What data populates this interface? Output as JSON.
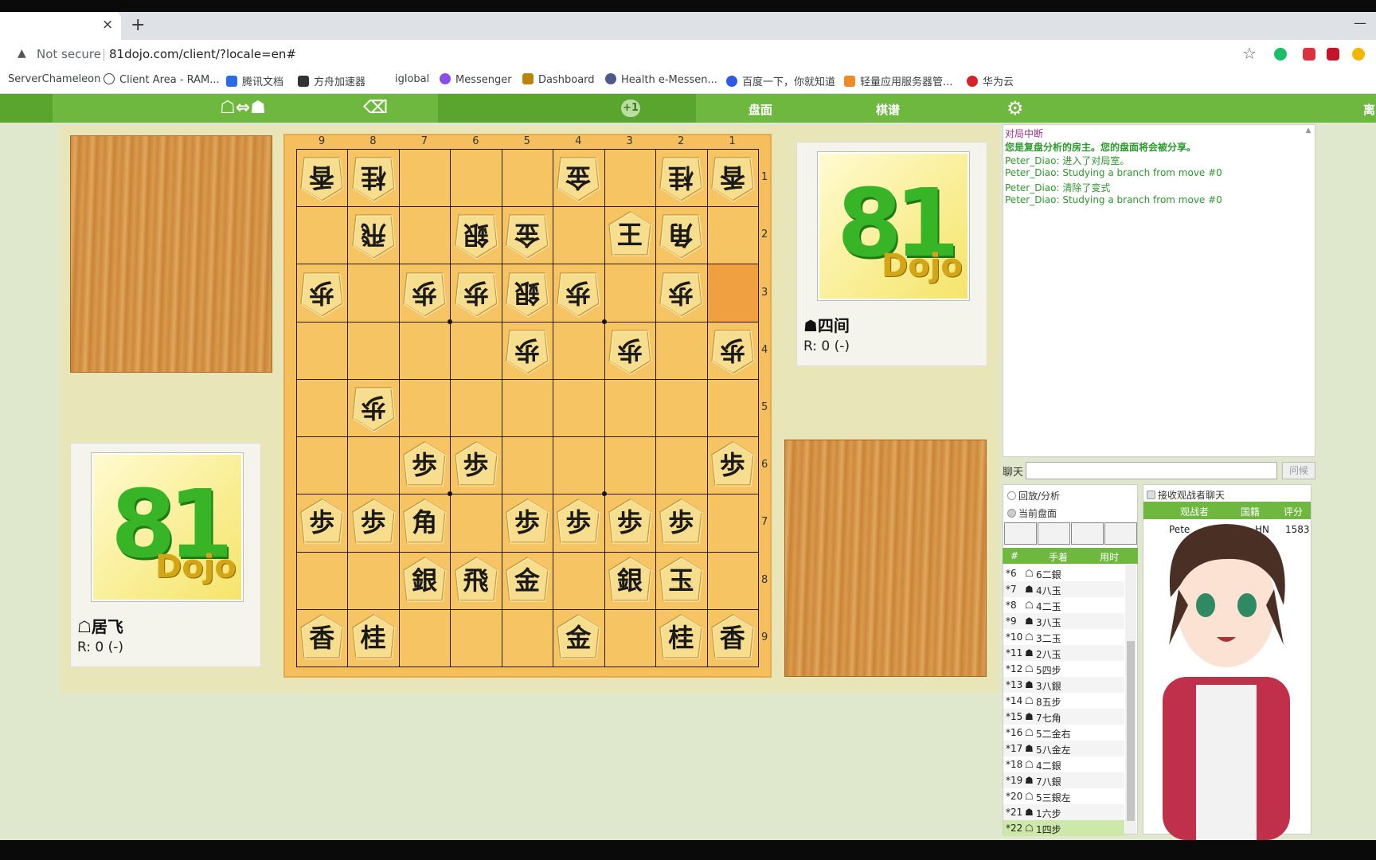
{
  "browser": {
    "tab_close": "×",
    "tab_new": "+",
    "security_label": "Not secure",
    "url": "81dojo.com/client/?locale=en#",
    "bookmarks": [
      "ServerChameleon",
      "Client Area - RAM...",
      "腾讯文档",
      "方舟加速器",
      "iglobal",
      "Messenger",
      "Dashboard",
      "Health e-Messen...",
      "百度一下，你就知道",
      "轻量应用服务器管...",
      "华为云"
    ]
  },
  "toolbar": {
    "plus_badge": "+1",
    "board_label": "盘面",
    "kifu_label": "棋谱",
    "leave_label": "离"
  },
  "board": {
    "files": [
      "9",
      "8",
      "7",
      "6",
      "5",
      "4",
      "3",
      "2",
      "1"
    ],
    "ranks": [
      "1",
      "2",
      "3",
      "4",
      "5",
      "6",
      "7",
      "8",
      "9"
    ],
    "pieces": [
      {
        "f": 9,
        "r": 1,
        "k": "香",
        "g": true
      },
      {
        "f": 8,
        "r": 1,
        "k": "桂",
        "g": true
      },
      {
        "f": 4,
        "r": 1,
        "k": "金",
        "g": true
      },
      {
        "f": 2,
        "r": 1,
        "k": "桂",
        "g": true
      },
      {
        "f": 1,
        "r": 1,
        "k": "香",
        "g": true
      },
      {
        "f": 8,
        "r": 2,
        "k": "飛",
        "g": true
      },
      {
        "f": 6,
        "r": 2,
        "k": "銀",
        "g": true
      },
      {
        "f": 5,
        "r": 2,
        "k": "金",
        "g": true
      },
      {
        "f": 3,
        "r": 2,
        "k": "王",
        "g": false
      },
      {
        "f": 2,
        "r": 2,
        "k": "角",
        "g": true
      },
      {
        "f": 9,
        "r": 3,
        "k": "歩",
        "g": true
      },
      {
        "f": 7,
        "r": 3,
        "k": "歩",
        "g": true
      },
      {
        "f": 6,
        "r": 3,
        "k": "歩",
        "g": true
      },
      {
        "f": 5,
        "r": 3,
        "k": "銀",
        "g": true
      },
      {
        "f": 4,
        "r": 3,
        "k": "歩",
        "g": true
      },
      {
        "f": 2,
        "r": 3,
        "k": "歩",
        "g": true
      },
      {
        "f": 5,
        "r": 4,
        "k": "歩",
        "g": true
      },
      {
        "f": 3,
        "r": 4,
        "k": "歩",
        "g": true
      },
      {
        "f": 1,
        "r": 4,
        "k": "歩",
        "g": true
      },
      {
        "f": 8,
        "r": 5,
        "k": "歩",
        "g": true
      },
      {
        "f": 7,
        "r": 6,
        "k": "歩",
        "g": false
      },
      {
        "f": 6,
        "r": 6,
        "k": "歩",
        "g": false
      },
      {
        "f": 1,
        "r": 6,
        "k": "歩",
        "g": false
      },
      {
        "f": 9,
        "r": 7,
        "k": "歩",
        "g": false
      },
      {
        "f": 8,
        "r": 7,
        "k": "歩",
        "g": false
      },
      {
        "f": 7,
        "r": 7,
        "k": "角",
        "g": false
      },
      {
        "f": 5,
        "r": 7,
        "k": "歩",
        "g": false
      },
      {
        "f": 4,
        "r": 7,
        "k": "歩",
        "g": false
      },
      {
        "f": 3,
        "r": 7,
        "k": "歩",
        "g": false
      },
      {
        "f": 2,
        "r": 7,
        "k": "歩",
        "g": false
      },
      {
        "f": 7,
        "r": 8,
        "k": "銀",
        "g": false
      },
      {
        "f": 6,
        "r": 8,
        "k": "飛",
        "g": false
      },
      {
        "f": 5,
        "r": 8,
        "k": "金",
        "g": false
      },
      {
        "f": 3,
        "r": 8,
        "k": "銀",
        "g": false
      },
      {
        "f": 2,
        "r": 8,
        "k": "玉",
        "g": false
      },
      {
        "f": 9,
        "r": 9,
        "k": "香",
        "g": false
      },
      {
        "f": 8,
        "r": 9,
        "k": "桂",
        "g": false
      },
      {
        "f": 4,
        "r": 9,
        "k": "金",
        "g": false
      },
      {
        "f": 2,
        "r": 9,
        "k": "桂",
        "g": false
      },
      {
        "f": 1,
        "r": 9,
        "k": "香",
        "g": false
      }
    ],
    "highlight": {
      "f": 1,
      "r": 3
    }
  },
  "players": {
    "top": {
      "name": "☗四间",
      "rating": "R: 0 (-)"
    },
    "bottom": {
      "name": "☖居飞",
      "rating": "R: 0 (-)"
    },
    "logo_big": "81",
    "logo_small": "Dojo"
  },
  "chat": {
    "messages": [
      {
        "text": "对局中断",
        "color": "#a0308a",
        "bold": false
      },
      {
        "text": "您是复盘分析的房主。您的盘面将会被分享。",
        "color": "#2b9a2b",
        "bold": true
      },
      {
        "text": "Peter_Diao: 进入了对局室。",
        "color": "#2b9a2b",
        "bold": false
      },
      {
        "text": "Peter_Diao: Studying a branch from move #0",
        "color": "#2b9a2b",
        "bold": false
      },
      {
        "text": "Peter_Diao: 清除了变式",
        "color": "#2b9a2b",
        "bold": false
      },
      {
        "text": "Peter_Diao: Studying a branch from move #0",
        "color": "#2b9a2b",
        "bold": false
      }
    ],
    "label": "聊天",
    "send_label": "问候"
  },
  "kifu": {
    "radio_replay": "回放/分析",
    "radio_current": "当前盘面",
    "col_num": "#",
    "col_move": "手着",
    "col_time": "用时",
    "moves": [
      {
        "n": "*6",
        "s": "☖",
        "m": "6二銀"
      },
      {
        "n": "*7",
        "s": "☗",
        "m": "4八玉"
      },
      {
        "n": "*8",
        "s": "☖",
        "m": "4二玉"
      },
      {
        "n": "*9",
        "s": "☗",
        "m": "3八玉"
      },
      {
        "n": "*10",
        "s": "☖",
        "m": "3二玉"
      },
      {
        "n": "*11",
        "s": "☗",
        "m": "2八玉"
      },
      {
        "n": "*12",
        "s": "☖",
        "m": "5四步"
      },
      {
        "n": "*13",
        "s": "☗",
        "m": "3八銀"
      },
      {
        "n": "*14",
        "s": "☖",
        "m": "8五步"
      },
      {
        "n": "*15",
        "s": "☗",
        "m": "7七角"
      },
      {
        "n": "*16",
        "s": "☖",
        "m": "5二金右"
      },
      {
        "n": "*17",
        "s": "☗",
        "m": "5八金左"
      },
      {
        "n": "*18",
        "s": "☖",
        "m": "4二銀"
      },
      {
        "n": "*19",
        "s": "☗",
        "m": "7八銀"
      },
      {
        "n": "*20",
        "s": "☖",
        "m": "5三銀左"
      },
      {
        "n": "*21",
        "s": "☗",
        "m": "1六步"
      },
      {
        "n": "*22",
        "s": "☖",
        "m": "1四步"
      }
    ]
  },
  "watchers": {
    "checkbox_label": "接收观战者聊天",
    "col_name": "观战者",
    "col_country": "国籍",
    "col_rating": "评分",
    "rows": [
      {
        "name": "Pete",
        "country": "HN",
        "rating": "1583"
      }
    ]
  }
}
